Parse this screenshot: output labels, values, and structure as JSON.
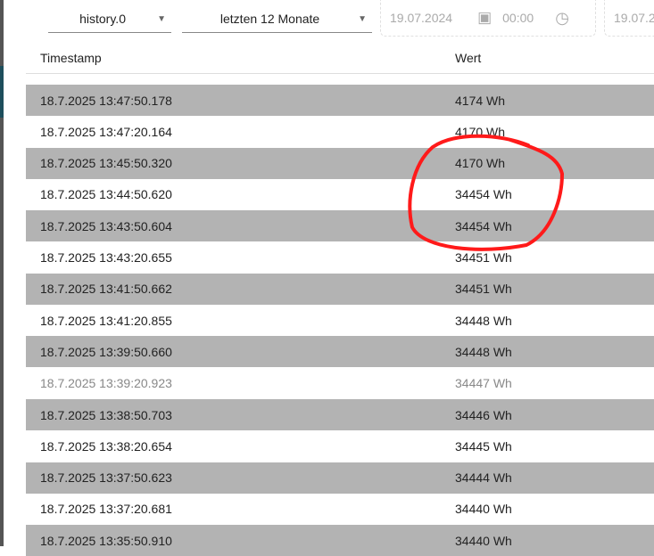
{
  "toolbar": {
    "instance": "history.0",
    "range": "letzten 12 Monate",
    "start_date": "19.07.2024",
    "start_time": "00:00",
    "end_date": "19.07.2"
  },
  "table": {
    "headers": [
      "Timestamp",
      "Wert"
    ],
    "rows": [
      [
        "18.7.2025 13:47:50.178",
        "4174 Wh"
      ],
      [
        "18.7.2025 13:47:20.164",
        "4170 Wh"
      ],
      [
        "18.7.2025 13:45:50.320",
        "4170 Wh"
      ],
      [
        "18.7.2025 13:44:50.620",
        "34454 Wh"
      ],
      [
        "18.7.2025 13:43:50.604",
        "34454 Wh"
      ],
      [
        "18.7.2025 13:43:20.655",
        "34451 Wh"
      ],
      [
        "18.7.2025 13:41:50.662",
        "34451 Wh"
      ],
      [
        "18.7.2025 13:41:20.855",
        "34448 Wh"
      ],
      [
        "18.7.2025 13:39:50.660",
        "34448 Wh"
      ],
      [
        "18.7.2025 13:39:20.923",
        "34447 Wh"
      ],
      [
        "18.7.2025 13:38:50.703",
        "34446 Wh"
      ],
      [
        "18.7.2025 13:38:20.654",
        "34445 Wh"
      ],
      [
        "18.7.2025 13:37:50.623",
        "34444 Wh"
      ],
      [
        "18.7.2025 13:37:20.681",
        "34440 Wh"
      ],
      [
        "18.7.2025 13:35:50.910",
        "34440 Wh"
      ]
    ]
  },
  "colors": {
    "annotation": "#ff1a1a",
    "row_alt": "#b3b3b3"
  }
}
